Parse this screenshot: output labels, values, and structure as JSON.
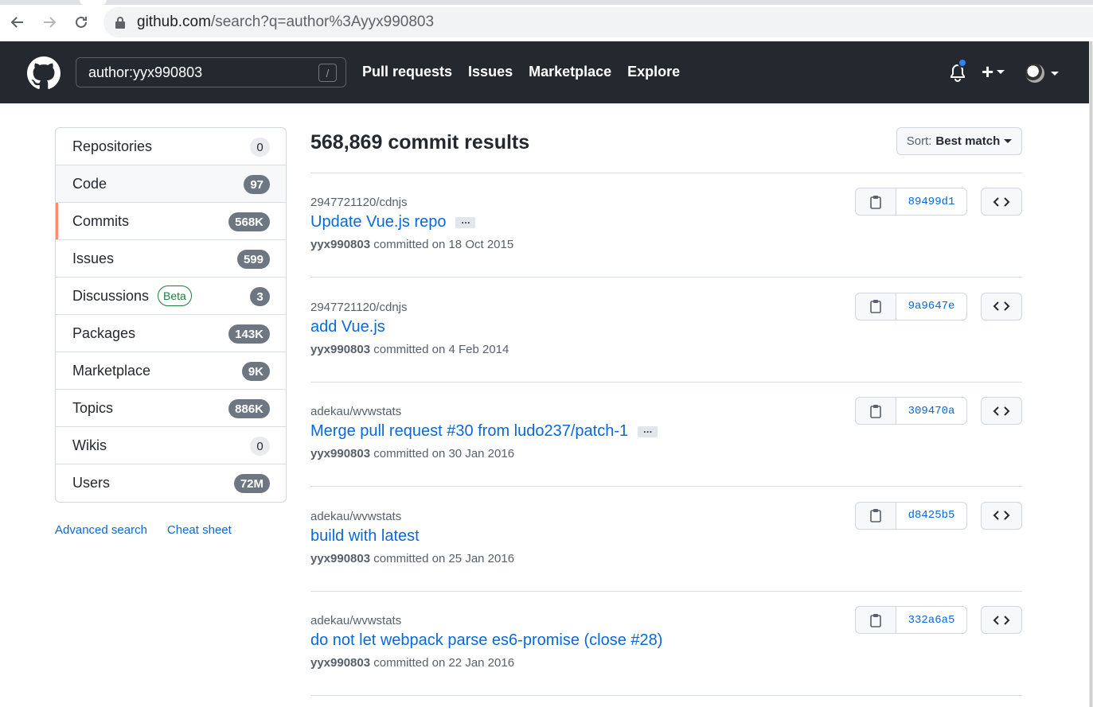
{
  "browser": {
    "url_host": "github.com",
    "url_rest": "/search?q=author%3Ayyx990803",
    "back_icon": "arrow-left-icon",
    "forward_icon": "arrow-right-icon",
    "reload_icon": "reload-icon",
    "lock_icon": "lock-icon"
  },
  "header": {
    "search_value": "author:yyx990803",
    "slash_hint": "/",
    "nav": [
      "Pull requests",
      "Issues",
      "Marketplace",
      "Explore"
    ],
    "plus_label": "+",
    "notification_dot_color": "#2f81f7"
  },
  "sidebar": {
    "items": [
      {
        "label": "Repositories",
        "count": "0"
      },
      {
        "label": "Code",
        "count": "97"
      },
      {
        "label": "Commits",
        "count": "568K"
      },
      {
        "label": "Issues",
        "count": "599"
      },
      {
        "label": "Discussions",
        "badge": "Beta",
        "count": "3"
      },
      {
        "label": "Packages",
        "count": "143K"
      },
      {
        "label": "Marketplace",
        "count": "9K"
      },
      {
        "label": "Topics",
        "count": "886K"
      },
      {
        "label": "Wikis",
        "count": "0"
      },
      {
        "label": "Users",
        "count": "72M"
      }
    ],
    "links": [
      "Advanced search",
      "Cheat sheet"
    ],
    "selected_accent": "#fd8c73"
  },
  "main": {
    "title": "568,869 commit results",
    "sort_label": "Sort:",
    "sort_value": "Best match",
    "ellipsis": "…",
    "commits": [
      {
        "repo": "2947721120/cdnjs",
        "message": "Update Vue.js repo",
        "has_more": true,
        "author": "yyx990803",
        "committed_text": "committed on 18 Oct 2015",
        "sha": "89499d1"
      },
      {
        "repo": "2947721120/cdnjs",
        "message": "add Vue.js",
        "has_more": false,
        "author": "yyx990803",
        "committed_text": "committed on 4 Feb 2014",
        "sha": "9a9647e"
      },
      {
        "repo": "adekau/wvwstats",
        "message": "Merge pull request #30 from ludo237/patch-1",
        "has_more": true,
        "author": "yyx990803",
        "committed_text": "committed on 30 Jan 2016",
        "sha": "309470a"
      },
      {
        "repo": "adekau/wvwstats",
        "message": "build with latest",
        "has_more": false,
        "author": "yyx990803",
        "committed_text": "committed on 25 Jan 2016",
        "sha": "d8425b5"
      },
      {
        "repo": "adekau/wvwstats",
        "message": "do not let webpack parse es6-promise (close #28)",
        "has_more": false,
        "author": "yyx990803",
        "committed_text": "committed on 22 Jan 2016",
        "sha": "332a6a5"
      }
    ],
    "link_color": "#0969da"
  }
}
